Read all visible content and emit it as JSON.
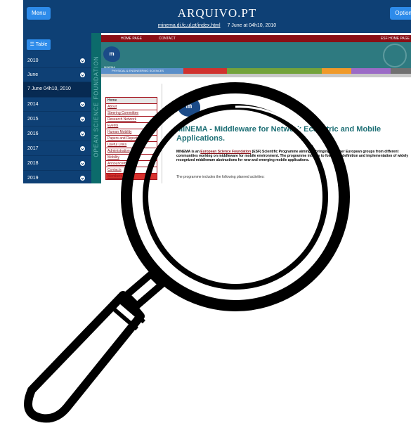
{
  "toolbar": {
    "menu_label": "Menu",
    "logo": "ARQUIVO.PT",
    "options_label": "Options",
    "url": "minema.di.fc.ul.pt/index.html",
    "date": "7 June at 04h10, 2010"
  },
  "sidebar": {
    "table_label": "Table",
    "items": [
      {
        "label": "2010",
        "selected": false
      },
      {
        "label": "June",
        "selected": false
      },
      {
        "label": "7 June 04h10, 2010",
        "selected": true
      },
      {
        "label": "2014",
        "selected": false
      },
      {
        "label": "2015",
        "selected": false
      },
      {
        "label": "2016",
        "selected": false
      },
      {
        "label": "2017",
        "selected": false
      },
      {
        "label": "2018",
        "selected": false
      },
      {
        "label": "2019",
        "selected": false
      }
    ]
  },
  "archived": {
    "vertical_text": "OPEAN SCIENCE FOUNDATION",
    "topnav": {
      "home": "HOME PAGE",
      "contact": "CONTACT",
      "esf_home": "ESF HOME PAGE"
    },
    "minema_label": "MINEMA",
    "banner": "PHYSICAL & ENGINEERING SCIENCES",
    "logo_text": "m",
    "nav": [
      "Home",
      "About",
      "Steering Committee",
      "Research Network",
      "Events",
      "Human Mobility",
      "Papers and Reports",
      "Useful Links",
      "Administration",
      "Mobility",
      "Announcements",
      "Contacts",
      "Members Only"
    ],
    "title": "MINEMA - Middleware for Network Eccentric and Mobile Applications.",
    "intro_pre": "MINEMA is an ",
    "intro_link": "European Science Foundation",
    "intro_post": " (ESF) Scientific Programme aiming at bringing together European groups from different communities working on middleware for mobile environment. The programme intends to foster the definition and implementation of widely recognized middleware abstractions for new and emerging mobile applications.",
    "planned": "The programme includes the following planned activities:"
  },
  "colors": {
    "arquivo_blue": "#0e4075",
    "button_blue": "#2d8bea",
    "esf_red": "#8a0f16",
    "esf_teal": "#2e7a80",
    "title_teal": "#1d6f75"
  }
}
